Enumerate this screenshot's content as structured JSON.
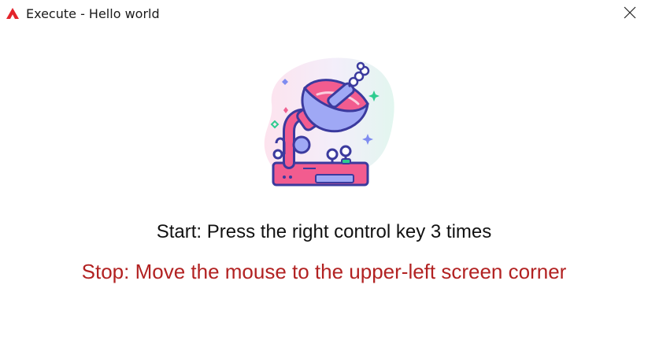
{
  "window": {
    "title": "Execute - Hello world",
    "app_icon": "automa-logo-icon",
    "close_icon": "close-icon"
  },
  "illustration": {
    "icon": "satellite-dish-icon"
  },
  "instructions": {
    "start": "Start: Press the right control key 3 times",
    "stop": "Stop: Move the mouse to the upper-left screen corner"
  },
  "colors": {
    "stop_text": "#b22222",
    "start_text": "#111111",
    "brand_red": "#e3242b"
  }
}
